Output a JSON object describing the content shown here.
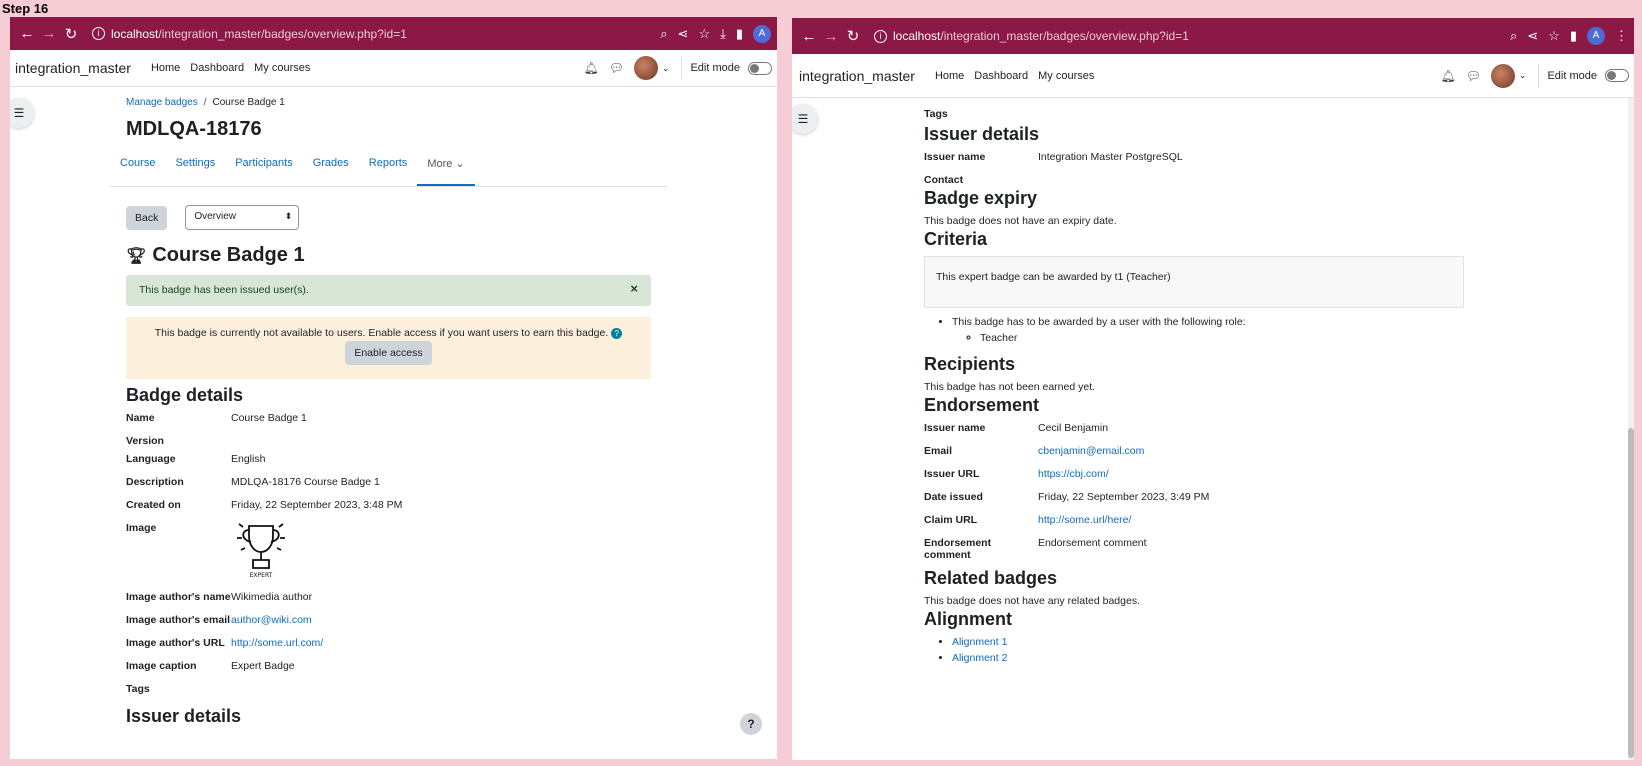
{
  "step_label": "Step 16",
  "browser": {
    "url_host": "localhost",
    "url_path": "/integration_master/badges/overview.php?id=1",
    "avatar_letter": "A"
  },
  "site": {
    "name": "integration_master",
    "nav": [
      "Home",
      "Dashboard",
      "My courses"
    ],
    "edit_mode_label": "Edit mode"
  },
  "left": {
    "breadcrumb": [
      "Manage badges",
      "Course Badge 1"
    ],
    "course_title": "MDLQA-18176",
    "tabs": [
      "Course",
      "Settings",
      "Participants",
      "Grades",
      "Reports",
      "More ⌄"
    ],
    "back_label": "Back",
    "select_value": "Overview",
    "badge_title": "Course Badge 1",
    "alert_success": "This badge has been issued user(s).",
    "alert_warning": "This badge is currently not available to users. Enable access if you want users to earn this badge.",
    "enable_access_label": "Enable access",
    "badge_details_heading": "Badge details",
    "details": [
      {
        "k": "Name",
        "v": "Course Badge 1"
      },
      {
        "k": "Version",
        "v": ""
      },
      {
        "k": "Language",
        "v": "English"
      },
      {
        "k": "Description",
        "v": "MDLQA-18176 Course Badge 1"
      },
      {
        "k": "Created on",
        "v": "Friday, 22 September 2023, 3:48 PM"
      }
    ],
    "image_label": "Image",
    "image_caption_text": "EXPERT",
    "details2": [
      {
        "k": "Image author's name",
        "v": "Wikimedia author"
      },
      {
        "k": "Image author's email",
        "v": "author@wiki.com",
        "link": true
      },
      {
        "k": "Image author's URL",
        "v": "http://some.url.com/",
        "link": true
      },
      {
        "k": "Image caption",
        "v": "Expert Badge"
      }
    ],
    "tags_label": "Tags",
    "issuer_heading_partial": "Issuer details"
  },
  "right": {
    "tags_label": "Tags",
    "issuer_heading": "Issuer details",
    "issuer_name_label": "Issuer name",
    "issuer_name_value": "Integration Master PostgreSQL",
    "contact_label": "Contact",
    "expiry_heading": "Badge expiry",
    "expiry_text": "This badge does not have an expiry date.",
    "criteria_heading": "Criteria",
    "criteria_box": "This expert badge can be awarded by t1 (Teacher)",
    "criteria_item": "This badge has to be awarded by a user with the following role:",
    "criteria_subitem": "Teacher",
    "recipients_heading": "Recipients",
    "recipients_text": "This badge has not been earned yet.",
    "endorsement_heading": "Endorsement",
    "endorsement": [
      {
        "k": "Issuer name",
        "v": "Cecil Benjamin"
      },
      {
        "k": "Email",
        "v": "cbenjamin@email.com",
        "link": true
      },
      {
        "k": "Issuer URL",
        "v": "https://cbj.com/",
        "link": true
      },
      {
        "k": "Date issued",
        "v": "Friday, 22 September 2023, 3:49 PM"
      },
      {
        "k": "Claim URL",
        "v": "http://some.url/here/",
        "link": true
      },
      {
        "k": "Endorsement comment",
        "v": "Endorsement comment"
      }
    ],
    "related_heading": "Related badges",
    "related_text": "This badge does not have any related badges.",
    "alignment_heading": "Alignment",
    "alignments": [
      "Alignment 1",
      "Alignment 2"
    ]
  },
  "colors": {
    "chrome": "#8c1846",
    "link": "#0f6cbf",
    "success_bg": "#d7e6d7",
    "warning_bg": "#fcefdc"
  }
}
